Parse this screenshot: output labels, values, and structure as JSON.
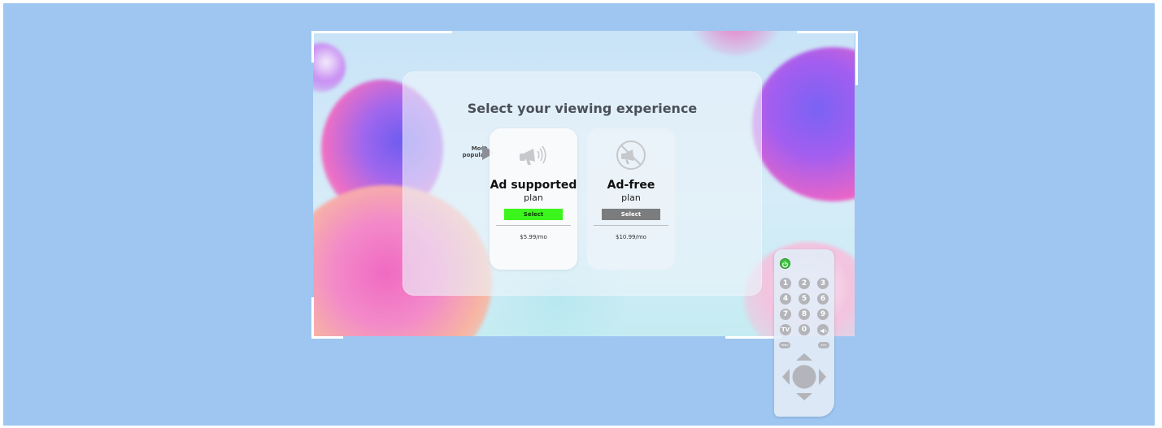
{
  "screen": {
    "title": "Select your viewing experience",
    "badge": {
      "line1": "Most",
      "line2": "popular"
    },
    "plans": [
      {
        "name": "Ad supported",
        "subtitle": "plan",
        "select_label": "Select",
        "price": "$5.99/mo",
        "icon": "megaphone-icon",
        "button_color": "#3cf51c",
        "highlighted": true
      },
      {
        "name": "Ad-free",
        "subtitle": "plan",
        "select_label": "Select",
        "price": "$10.99/mo",
        "icon": "no-ads-icon",
        "button_color": "#7b7c7e",
        "highlighted": false
      }
    ]
  },
  "remote": {
    "power_icon": "power-icon",
    "number_keys": [
      "1",
      "2",
      "3",
      "4",
      "5",
      "6",
      "7",
      "8",
      "9"
    ],
    "tv_label": "TV",
    "zero_label": "0",
    "mute_icon": "mute-icon",
    "menu_label": "MENU",
    "exit_label": "EXIT",
    "dpad_icons": [
      "up-arrow-icon",
      "left-arrow-icon",
      "ok-button",
      "right-arrow-icon",
      "down-arrow-icon"
    ]
  },
  "colors": {
    "background": "#9ec6f0",
    "accent_green": "#3cf51c",
    "neutral_button": "#7b7c7e"
  }
}
